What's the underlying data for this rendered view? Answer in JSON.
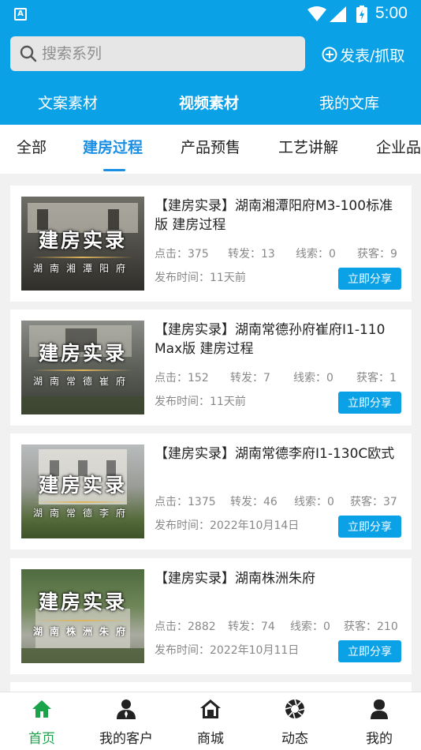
{
  "status_bar": {
    "time": "5:00"
  },
  "search": {
    "placeholder": "搜索系列"
  },
  "header": {
    "post_label": "发表/抓取"
  },
  "main_tabs": [
    {
      "label": "文案素材",
      "active": false
    },
    {
      "label": "视频素材",
      "active": true
    },
    {
      "label": "我的文库",
      "active": false
    }
  ],
  "sub_tabs": [
    {
      "label": "全部",
      "active": false
    },
    {
      "label": "建房过程",
      "active": true
    },
    {
      "label": "产品预售",
      "active": false
    },
    {
      "label": "工艺讲解",
      "active": false
    },
    {
      "label": "企业品",
      "active": false
    }
  ],
  "cards": [
    {
      "thumb_title": "建房实录",
      "thumb_subtitle": "湖南湘潭阳府",
      "title": "【建房实录】湖南湘潭阳府M3-100标准版 建房过程",
      "clicks": "点击：375",
      "forwards": "转发：13",
      "leads": "线索：0",
      "customers": "获客：9",
      "date": "发布时间：11天前",
      "share": "立即分享"
    },
    {
      "thumb_title": "建房实录",
      "thumb_subtitle": "湖南常德崔府",
      "title": "【建房实录】湖南常德孙府崔府I1-110 Max版 建房过程",
      "clicks": "点击：152",
      "forwards": "转发：7",
      "leads": "线索：0",
      "customers": "获客：1",
      "date": "发布时间：11天前",
      "share": "立即分享"
    },
    {
      "thumb_title": "建房实录",
      "thumb_subtitle": "湖南常德李府",
      "title": "【建房实录】湖南常德李府I1-130C欧式",
      "clicks": "点击：1375",
      "forwards": "转发：46",
      "leads": "线索：0",
      "customers": "获客：37",
      "date": "发布时间：2022年10月14日",
      "share": "立即分享"
    },
    {
      "thumb_title": "建房实录",
      "thumb_subtitle": "湖南株洲朱府",
      "title": "【建房实录】湖南株洲朱府",
      "clicks": "点击：2882",
      "forwards": "转发：74",
      "leads": "线索：0",
      "customers": "获客：210",
      "date": "发布时间：2022年10月11日",
      "share": "立即分享"
    }
  ],
  "tabbar": [
    {
      "label": "首页",
      "icon": "home-icon",
      "active": true
    },
    {
      "label": "我的客户",
      "icon": "customer-icon",
      "active": false
    },
    {
      "label": "商城",
      "icon": "store-icon",
      "active": false
    },
    {
      "label": "动态",
      "icon": "aperture-icon",
      "active": false
    },
    {
      "label": "我的",
      "icon": "profile-icon",
      "active": false
    }
  ],
  "colors": {
    "brand": "#0aa1e6",
    "accent_tab": "#1a8fe3",
    "active_nav": "#1aa34a"
  }
}
